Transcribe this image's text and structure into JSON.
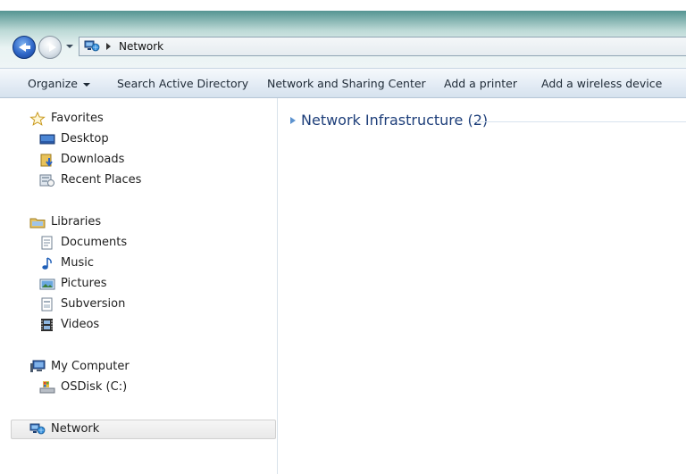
{
  "address": {
    "location": "Network",
    "location_icon": "network-icon"
  },
  "toolbar": {
    "organize_label": "Organize",
    "search_ad_label": "Search Active Directory",
    "sharing_center_label": "Network and Sharing Center",
    "add_printer_label": "Add a printer",
    "add_wireless_label": "Add a wireless device"
  },
  "sidebar": {
    "favorites": {
      "label": "Favorites",
      "icon": "star-icon",
      "items": [
        {
          "label": "Desktop",
          "icon": "desktop-icon"
        },
        {
          "label": "Downloads",
          "icon": "downloads-icon"
        },
        {
          "label": "Recent Places",
          "icon": "recent-places-icon"
        }
      ]
    },
    "libraries": {
      "label": "Libraries",
      "icon": "library-icon",
      "items": [
        {
          "label": "Documents",
          "icon": "documents-icon"
        },
        {
          "label": "Music",
          "icon": "music-icon"
        },
        {
          "label": "Pictures",
          "icon": "pictures-icon"
        },
        {
          "label": "Subversion",
          "icon": "subversion-icon"
        },
        {
          "label": "Videos",
          "icon": "videos-icon"
        }
      ]
    },
    "computer": {
      "label": "My Computer",
      "icon": "computer-icon",
      "items": [
        {
          "label": "OSDisk (C:)",
          "icon": "disk-icon"
        }
      ]
    },
    "network": {
      "label": "Network",
      "icon": "network-icon",
      "selected": true
    }
  },
  "content": {
    "group_label": "Network Infrastructure (2)",
    "group_expanded": false
  },
  "colors": {
    "accent": "#1e3f7a",
    "selection": "#e9e9e9"
  }
}
